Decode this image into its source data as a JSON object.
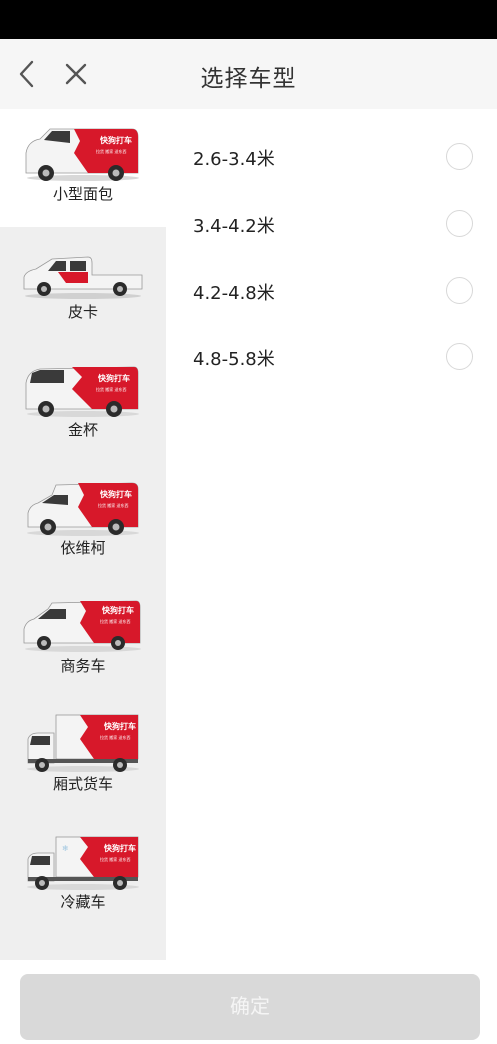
{
  "header": {
    "title": "选择车型",
    "back_icon": "chevron-left-icon",
    "close_icon": "close-icon"
  },
  "brand": {
    "red": "#d7182a",
    "van_text": "快狗打车",
    "van_subtext": "拉货 搬家 送东西"
  },
  "sidebar": {
    "items": [
      {
        "label": "小型面包",
        "active": true
      },
      {
        "label": "皮卡",
        "active": false
      },
      {
        "label": "金杯",
        "active": false
      },
      {
        "label": "依维柯",
        "active": false
      },
      {
        "label": "商务车",
        "active": false
      },
      {
        "label": "厢式货车",
        "active": false
      },
      {
        "label": "冷藏车",
        "active": false
      }
    ]
  },
  "options": [
    {
      "label": "2.6-3.4米",
      "selected": false
    },
    {
      "label": "3.4-4.2米",
      "selected": false
    },
    {
      "label": "4.2-4.8米",
      "selected": false
    },
    {
      "label": "4.8-5.8米",
      "selected": false
    }
  ],
  "footer": {
    "confirm_label": "确定"
  }
}
